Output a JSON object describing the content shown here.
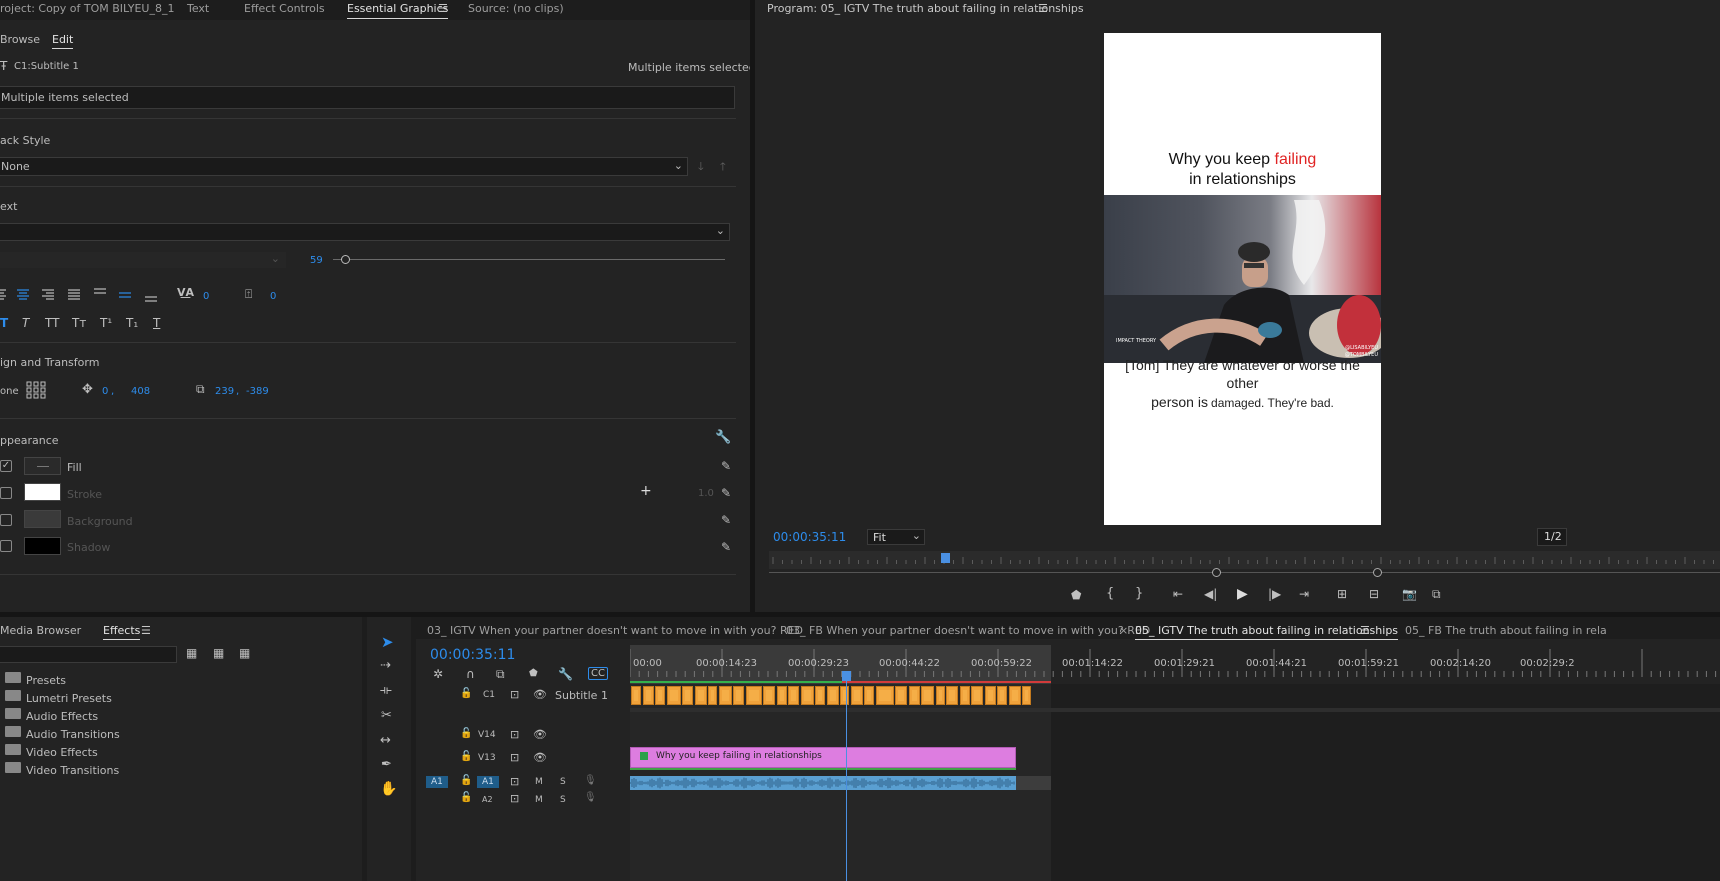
{
  "colors": {
    "accent": "#2d8ceb",
    "clip_orange": "#f0a23b",
    "clip_pink": "#dd7de0",
    "audio_blue": "#5a9fd1",
    "playhead": "#4a90e2"
  },
  "essential_graphics": {
    "tabs": [
      {
        "label": "roject: Copy of TOM BILYEU_8_1"
      },
      {
        "label": "Text"
      },
      {
        "label": "Effect Controls"
      },
      {
        "label": "Essential Graphics"
      },
      {
        "label": "Source: (no clips)"
      }
    ],
    "subtabs": {
      "browse": "Browse",
      "edit": "Edit"
    },
    "layer_name": "C1:Subtitle 1",
    "multiple_right": "Multiple items selected",
    "multiple_field": "Multiple items selected",
    "track_style_label": "ack Style",
    "track_style_value": "None",
    "text_label": "ext",
    "font_size": "59",
    "tracking": "0",
    "leading": "0",
    "style_buttons": [
      "T",
      "T",
      "TT",
      "Tт",
      "T¹",
      "T₁",
      "T"
    ],
    "align_label": "ign and Transform",
    "align_none": "one",
    "pos_x": "0",
    "pos_y": "408",
    "scale_x": "239",
    "scale_y": "-389",
    "comma": ",",
    "appearance_label": "ppearance",
    "appearance": [
      {
        "label": "Fill",
        "checked": true
      },
      {
        "label": "Stroke",
        "checked": false
      },
      {
        "label": "Background",
        "checked": false
      },
      {
        "label": "Shadow",
        "checked": false
      }
    ],
    "stroke_width": "1.0"
  },
  "program": {
    "title": "Program: 05_ IGTV The truth about failing in relationships",
    "menu_icon": "hamburger-icon",
    "timecode": "00:00:35:11",
    "zoom": "Fit",
    "resolution": "1/2",
    "video": {
      "headline_pre": "Why you keep",
      "headline_red": "failing",
      "headline_line2": "in relationships",
      "sub_line1": "[Tom] They are whatever or worse the",
      "sub_line2": "other",
      "sub_line3a": "person is",
      "sub_line3b": "damaged. They're bad.",
      "watermark_left": "IMPACT THEORY",
      "watermark_right1": "@LISABILYEU",
      "watermark_right2": "@TOMBILYEU"
    }
  },
  "project": {
    "tabs": [
      {
        "label": "Media Browser"
      },
      {
        "label": "Effects"
      }
    ],
    "search_value": "",
    "items": [
      {
        "label": "Presets"
      },
      {
        "label": "Lumetri Presets"
      },
      {
        "label": "Audio Effects"
      },
      {
        "label": "Audio Transitions"
      },
      {
        "label": "Video Effects"
      },
      {
        "label": "Video Transitions"
      }
    ]
  },
  "timeline": {
    "tabs": [
      {
        "label": "03_ IGTV When your partner doesn't want to move in with you? RED"
      },
      {
        "label": "03_ FB When your partner doesn't want to move in with you? RED"
      },
      {
        "label": "05_ IGTV The truth about failing in relationships"
      },
      {
        "label": "05_ FB The truth about failing in rela"
      }
    ],
    "close_icon": "×",
    "timecode": "00:00:35:11",
    "ruler": [
      "00:00",
      "00:00:14:23",
      "00:00:29:23",
      "00:00:44:22",
      "00:00:59:22",
      "00:01:14:22",
      "00:01:29:21",
      "00:01:44:21",
      "00:01:59:21",
      "00:02:14:20",
      "00:02:29:2"
    ],
    "tracks": {
      "c1": {
        "id": "C1",
        "name": "Subtitle 1"
      },
      "v14": {
        "id": "V14"
      },
      "v13": {
        "id": "V13"
      },
      "a1": {
        "src": "A1",
        "id": "A1",
        "m": "M",
        "s": "S"
      },
      "a2": {
        "id": "A2",
        "m": "M",
        "s": "S"
      }
    },
    "v13_clip_label": "Why you keep failing in relationships"
  }
}
